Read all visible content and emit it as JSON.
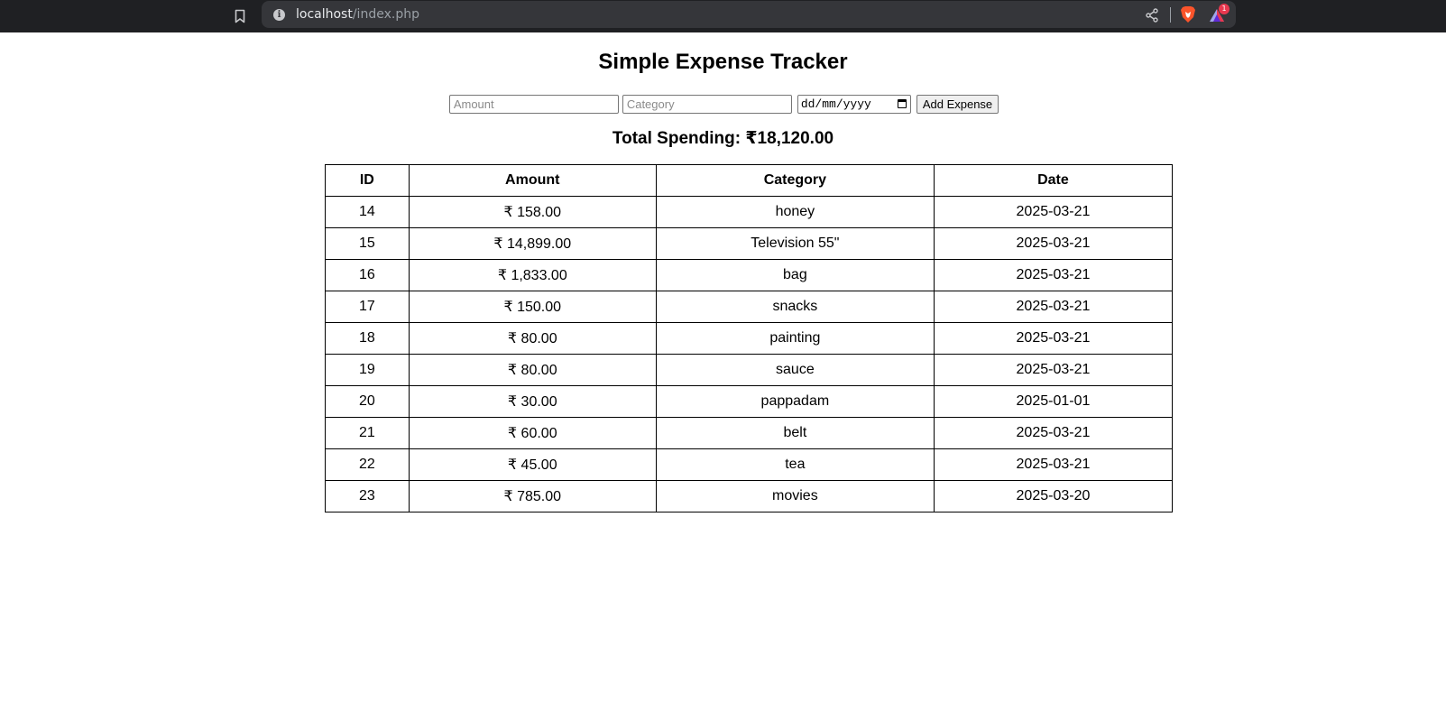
{
  "browser": {
    "url_host": "localhost",
    "url_path": "/index.php",
    "rewards_badge": "1",
    "icons": [
      "bookmark-icon",
      "info-icon",
      "share-icon",
      "brave-lion-icon",
      "brave-rewards-icon"
    ]
  },
  "page": {
    "title": "Simple Expense Tracker",
    "form": {
      "amount_placeholder": "Amount",
      "category_placeholder": "Category",
      "date_placeholder": "dd/mm/yyyy",
      "add_button": "Add Expense"
    },
    "total": "Total Spending: ₹18,120.00"
  },
  "table": {
    "headers": [
      "ID",
      "Amount",
      "Category",
      "Date"
    ],
    "rows": [
      [
        "14",
        "₹ 158.00",
        "honey",
        "2025-03-21"
      ],
      [
        "15",
        "₹ 14,899.00",
        "Television 55\"",
        "2025-03-21"
      ],
      [
        "16",
        "₹ 1,833.00",
        "bag",
        "2025-03-21"
      ],
      [
        "17",
        "₹ 150.00",
        "snacks",
        "2025-03-21"
      ],
      [
        "18",
        "₹ 80.00",
        "painting",
        "2025-03-21"
      ],
      [
        "19",
        "₹ 80.00",
        "sauce",
        "2025-03-21"
      ],
      [
        "20",
        "₹ 30.00",
        "pappadam",
        "2025-01-01"
      ],
      [
        "21",
        "₹ 60.00",
        "belt",
        "2025-03-21"
      ],
      [
        "22",
        "₹ 45.00",
        "tea",
        "2025-03-21"
      ],
      [
        "23",
        "₹ 785.00",
        "movies",
        "2025-03-20"
      ]
    ]
  }
}
